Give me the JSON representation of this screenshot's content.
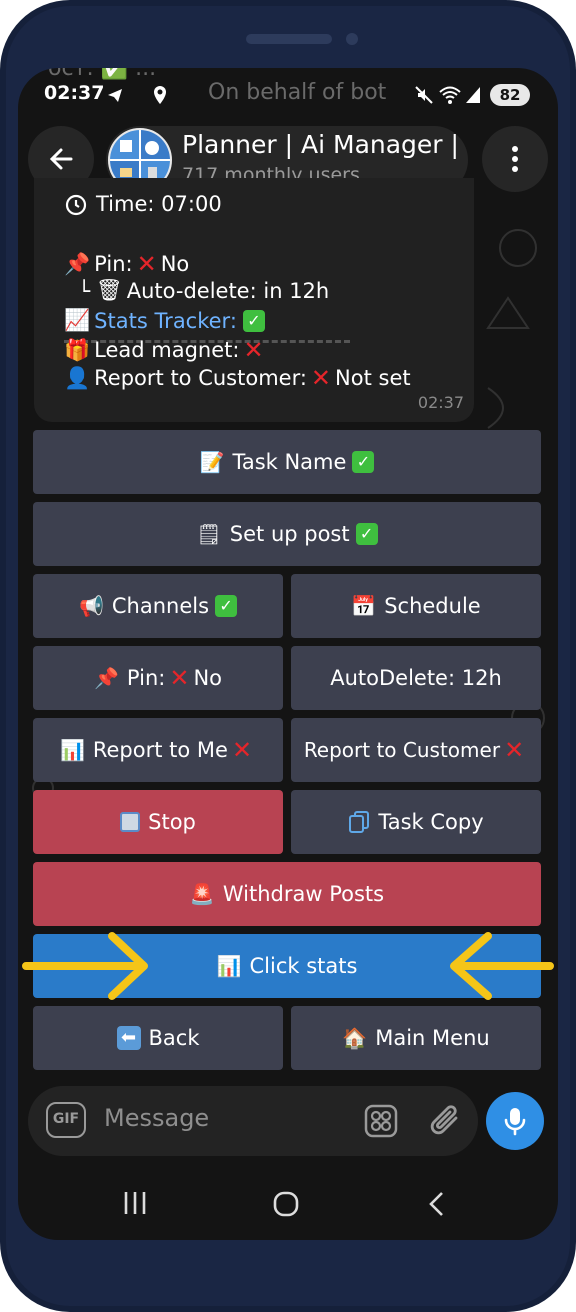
{
  "status": {
    "time": "02:37",
    "battery": "82"
  },
  "ghost": {
    "line1": "ост:  ✅  ...",
    "line2": "On behalf of bot"
  },
  "header": {
    "title": "Planner | Ai Manager | L",
    "subtitle": "717 monthly users"
  },
  "message": {
    "time_label": "Time:",
    "time_value": "07:00",
    "pin_label": "Pin:",
    "pin_value": "No",
    "autodelete_label": "Auto-delete:",
    "autodelete_value": "in 12h",
    "stats_label": "Stats Tracker:",
    "lead_label": "Lead magnet:",
    "report_label": "Report to Customer:",
    "report_value": "Not set",
    "sent_time": "02:37"
  },
  "keyboard": {
    "task_name": "Task Name",
    "setup_post": "Set up post",
    "channels": "Channels",
    "schedule": "Schedule",
    "pin": "Pin:",
    "pin_no": "No",
    "autodelete": "AutoDelete: 12h",
    "report_me": "Report to Me",
    "report_customer": "Report to Customer",
    "stop": "Stop",
    "task_copy": "Task Copy",
    "withdraw": "Withdraw Posts",
    "click_stats": "Click stats",
    "back": "Back",
    "main_menu": "Main Menu"
  },
  "composer": {
    "placeholder": "Message",
    "gif": "GIF"
  },
  "colors": {
    "accent_blue": "#2a7bc9",
    "danger_red": "#b84352",
    "button_gray": "#3d404f",
    "annotation_yellow": "#f5c518"
  },
  "icons": [
    "back-arrow-icon",
    "more-vert-icon",
    "clock-icon",
    "pushpin-icon",
    "trash-icon",
    "chart-icon",
    "gift-icon",
    "user-icon",
    "memo-icon",
    "notepad-icon",
    "megaphone-icon",
    "calendar-icon",
    "stop-icon",
    "copy-icon",
    "siren-icon",
    "left-arrow-icon",
    "house-icon",
    "gif-icon",
    "emoji-grid-icon",
    "paperclip-icon",
    "microphone-icon"
  ]
}
